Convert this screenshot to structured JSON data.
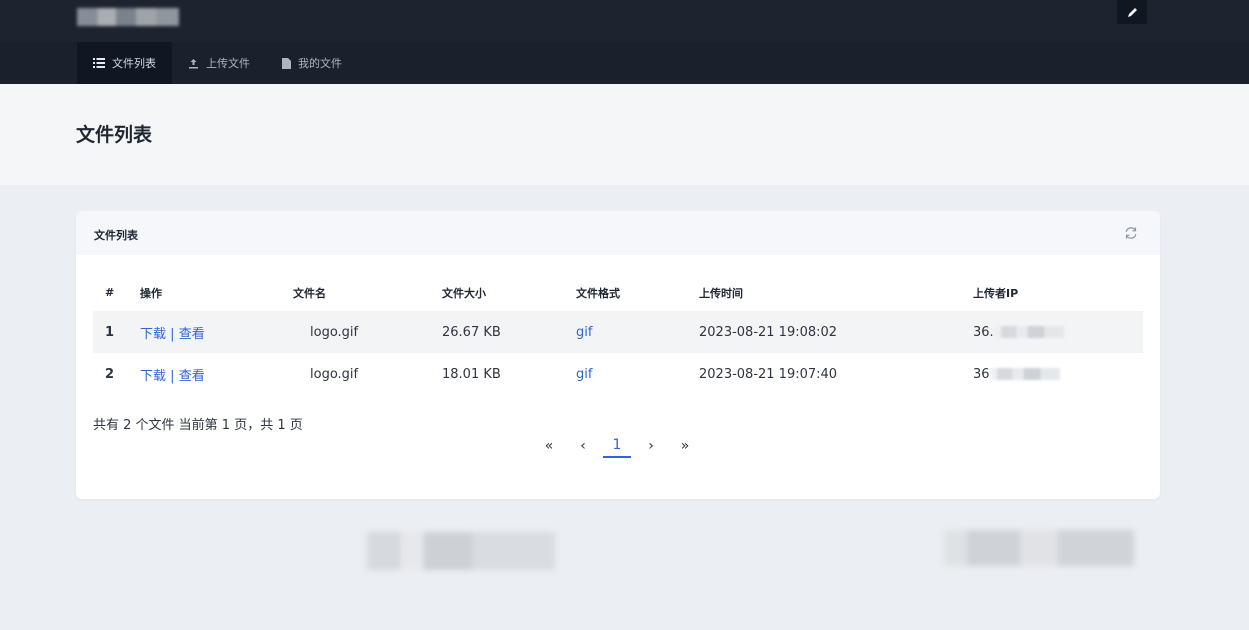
{
  "topbar": {
    "logo_icon": "blurred-logo",
    "edit_icon": "pen-icon",
    "nav": [
      {
        "label": "文件列表",
        "icon": "list-icon",
        "active": true
      },
      {
        "label": "上传文件",
        "icon": "upload-icon",
        "active": false
      },
      {
        "label": "我的文件",
        "icon": "file-icon",
        "active": false
      }
    ]
  },
  "page": {
    "title": "文件列表"
  },
  "card": {
    "title": "文件列表",
    "refresh_icon": "refresh-icon",
    "columns": [
      "#",
      "操作",
      "文件名",
      "文件大小",
      "文件格式",
      "上传时间",
      "上传者IP"
    ],
    "rows": [
      {
        "num": "1",
        "download": "下载",
        "sep": "|",
        "view": "查看",
        "name": "logo.gif",
        "size": "26.67 KB",
        "format": "gif",
        "time": "2023-08-21 19:08:02",
        "ip": "36."
      },
      {
        "num": "2",
        "download": "下载",
        "sep": "|",
        "view": "查看",
        "name": "logo.gif",
        "size": "18.01 KB",
        "format": "gif",
        "time": "2023-08-21 19:07:40",
        "ip": "36"
      }
    ],
    "summary": "共有 2 个文件  当前第 1 页，共 1 页",
    "pager": {
      "first": "«",
      "prev": "‹",
      "current": "1",
      "next": "›",
      "last": "»"
    }
  },
  "colors": {
    "topbar": "#1d2430",
    "accent": "#2f63d6",
    "page_bg": "#ebeef3"
  }
}
